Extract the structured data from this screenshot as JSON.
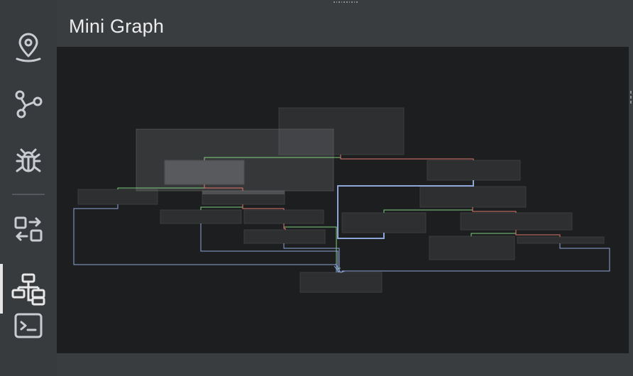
{
  "panel": {
    "title": "Mini Graph"
  },
  "sidebar": {
    "items": [
      {
        "icon": "location-pin-icon",
        "active": false
      },
      {
        "icon": "graph-nodes-icon",
        "active": false
      },
      {
        "icon": "bug-icon",
        "active": false
      },
      {
        "icon": "swap-arrows-icon",
        "active": false
      },
      {
        "icon": "hierarchy-icon",
        "active": true
      },
      {
        "icon": "terminal-icon",
        "active": false
      }
    ]
  },
  "colors": {
    "background": "#3a3d40",
    "graph_background": "#1c1e1f",
    "node": "#2d2f31",
    "viewport": "#4a4c4e",
    "edge_green": "#7fd07f",
    "edge_red": "#e07a6e",
    "edge_blue": "#8fa7d8",
    "icon": "#c9cdd1"
  }
}
